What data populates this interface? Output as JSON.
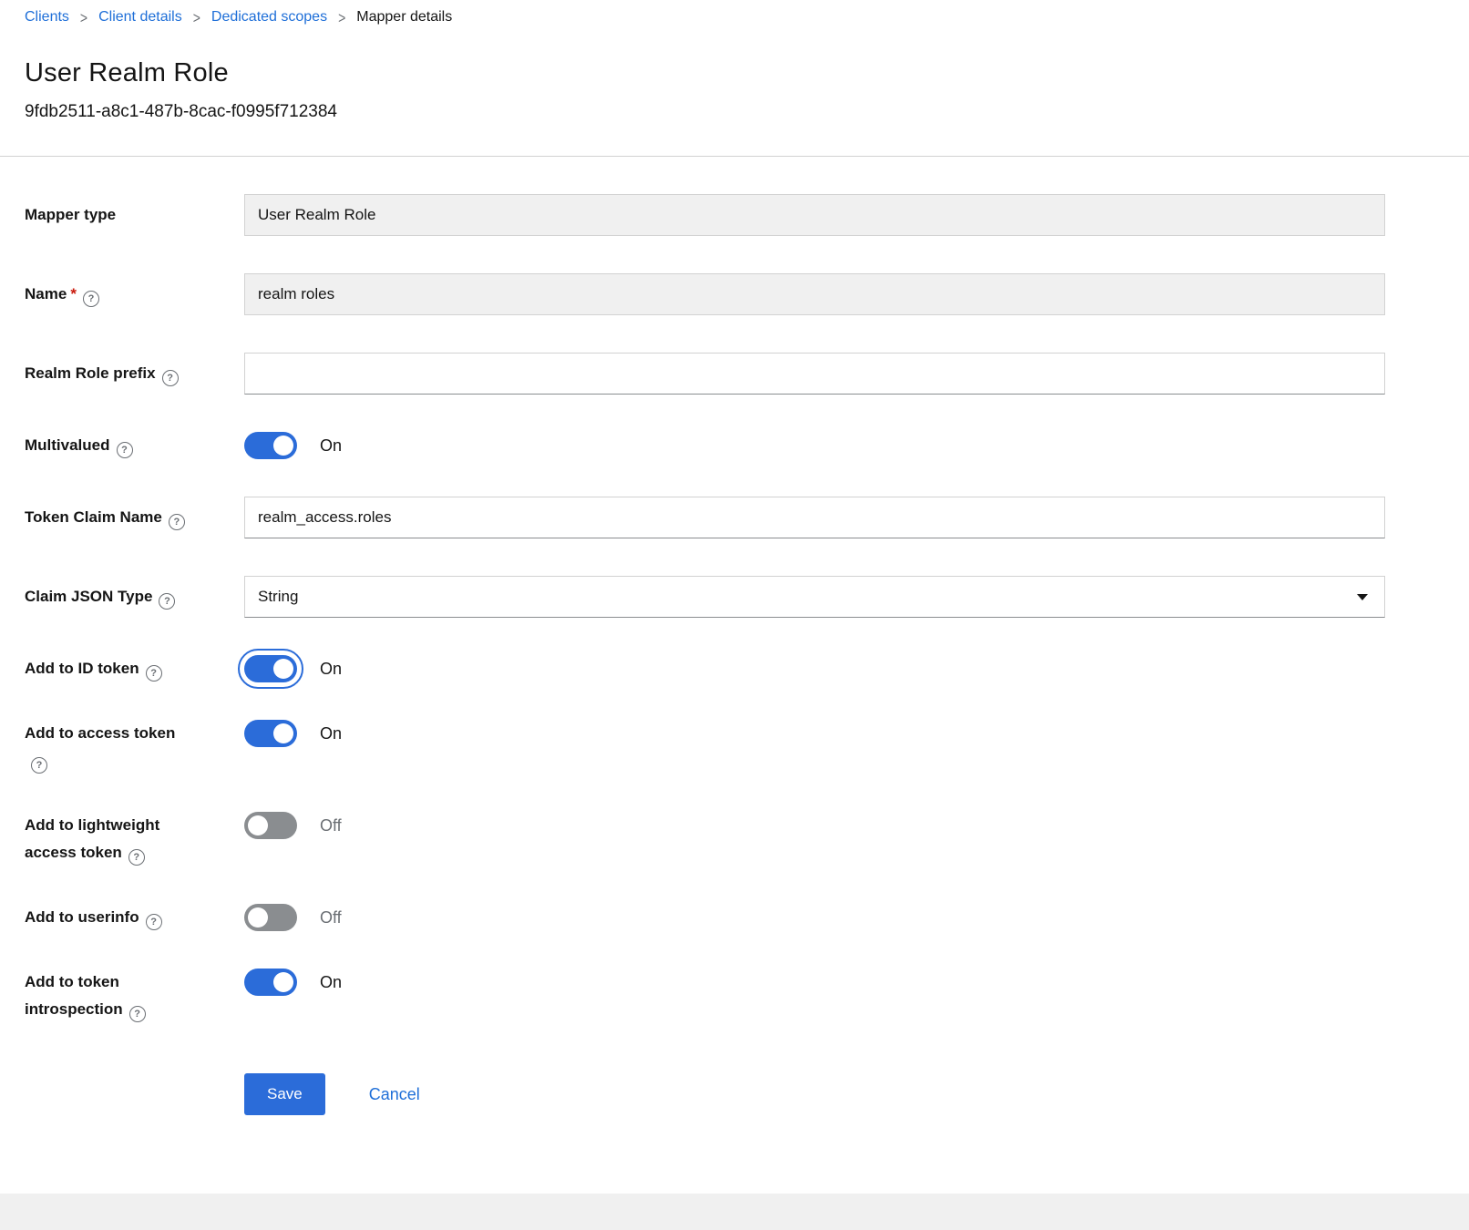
{
  "colors": {
    "link": "#1f6fd8",
    "primary": "#2b6cd9",
    "toggle-off": "#8a8d90",
    "danger": "#c9190b"
  },
  "breadcrumb": {
    "items": [
      {
        "label": "Clients"
      },
      {
        "label": "Client details"
      },
      {
        "label": "Dedicated scopes"
      },
      {
        "label": "Mapper details"
      }
    ]
  },
  "header": {
    "title": "User Realm Role",
    "subtitle": "9fdb2511-a8c1-487b-8cac-f0995f712384"
  },
  "form": {
    "mapper_type": {
      "label": "Mapper type",
      "value": "User Realm Role"
    },
    "name": {
      "label": "Name",
      "required": "*",
      "value": "realm roles"
    },
    "realm_role_prefix": {
      "label": "Realm Role prefix",
      "value": ""
    },
    "multivalued": {
      "label": "Multivalued",
      "state": "On"
    },
    "token_claim_name": {
      "label": "Token Claim Name",
      "value": "realm_access.roles"
    },
    "claim_json_type": {
      "label": "Claim JSON Type",
      "value": "String"
    },
    "add_to_id_token": {
      "label": "Add to ID token",
      "state": "On",
      "focused": true
    },
    "add_to_access_token": {
      "label": "Add to access token",
      "state": "On"
    },
    "add_to_lightweight_access_token": {
      "label": "Add to lightweight access token",
      "state": "Off"
    },
    "add_to_userinfo": {
      "label": "Add to userinfo",
      "state": "Off"
    },
    "add_to_token_introspection": {
      "label": "Add to token introspection",
      "state": "On"
    }
  },
  "actions": {
    "save": "Save",
    "cancel": "Cancel"
  }
}
